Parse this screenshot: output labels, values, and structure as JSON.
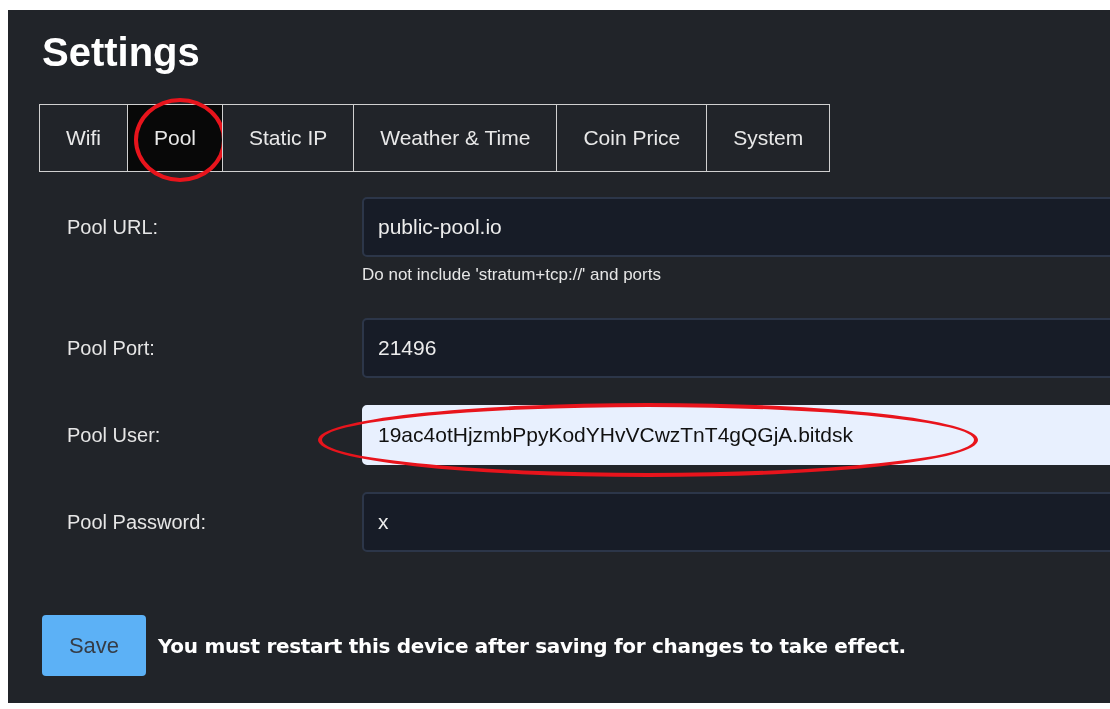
{
  "title": "Settings",
  "tabs": [
    {
      "label": "Wifi",
      "selected": false,
      "highlighted": false
    },
    {
      "label": "Pool",
      "selected": true,
      "highlighted": true
    },
    {
      "label": "Static IP",
      "selected": false,
      "highlighted": false
    },
    {
      "label": "Weather & Time",
      "selected": false,
      "highlighted": false
    },
    {
      "label": "Coin Price",
      "selected": false,
      "highlighted": false
    },
    {
      "label": "System",
      "selected": false,
      "highlighted": false
    }
  ],
  "fields": [
    {
      "label": "Pool URL:",
      "value": "public-pool.io",
      "help": "Do not include 'stratum+tcp://' and ports",
      "autofilled": false,
      "highlighted": false
    },
    {
      "label": "Pool Port:",
      "value": "21496",
      "autofilled": false,
      "highlighted": false
    },
    {
      "label": "Pool User:",
      "value": "19ac4otHjzmbPpyKodYHvVCwzTnT4gQGjA.bitdsk",
      "autofilled": true,
      "highlighted": true
    },
    {
      "label": "Pool Password:",
      "value": "x",
      "autofilled": false,
      "highlighted": false
    }
  ],
  "save_button": "Save",
  "notice": "You must restart this device after saving for changes to take effect."
}
